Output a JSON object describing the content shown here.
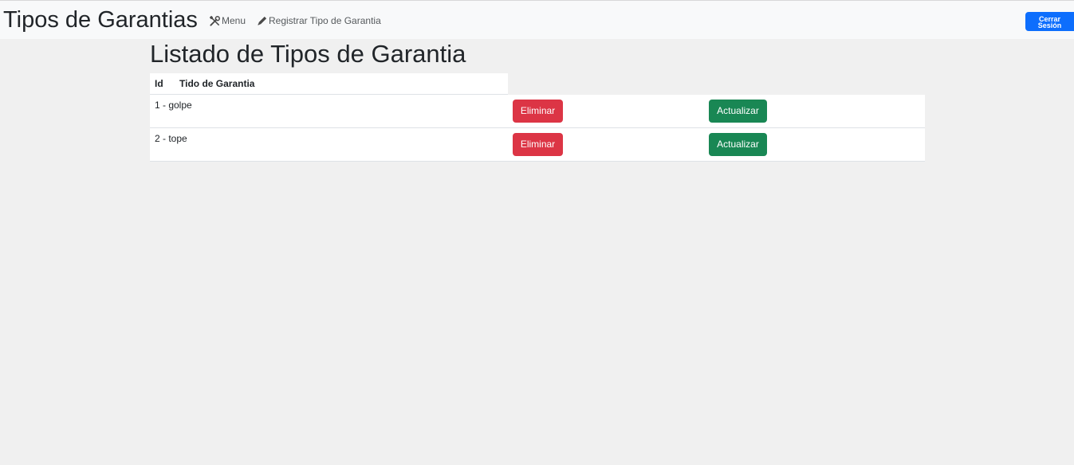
{
  "header": {
    "brand": "Tipos de Garantias",
    "nav": [
      {
        "label": "Menu",
        "icon": "tools-icon"
      },
      {
        "label": "Registrar Tipo de Garantia",
        "icon": "pencil-icon"
      }
    ],
    "logout_line1": "Cerrar",
    "logout_line2": "Sesión"
  },
  "main": {
    "title": "Listado de Tipos de Garantia",
    "columns": [
      "Id",
      "Tido de Garantia"
    ],
    "rows": [
      {
        "text": "1 - golpe",
        "delete_label": "Eliminar",
        "update_label": "Actualizar"
      },
      {
        "text": "2 - tope",
        "delete_label": "Eliminar",
        "update_label": "Actualizar"
      }
    ]
  },
  "colors": {
    "primary": "#0d6efd",
    "danger": "#dc3545",
    "success": "#198754",
    "navbar_bg": "#f8f9fa",
    "page_bg": "#f0f0f0"
  }
}
